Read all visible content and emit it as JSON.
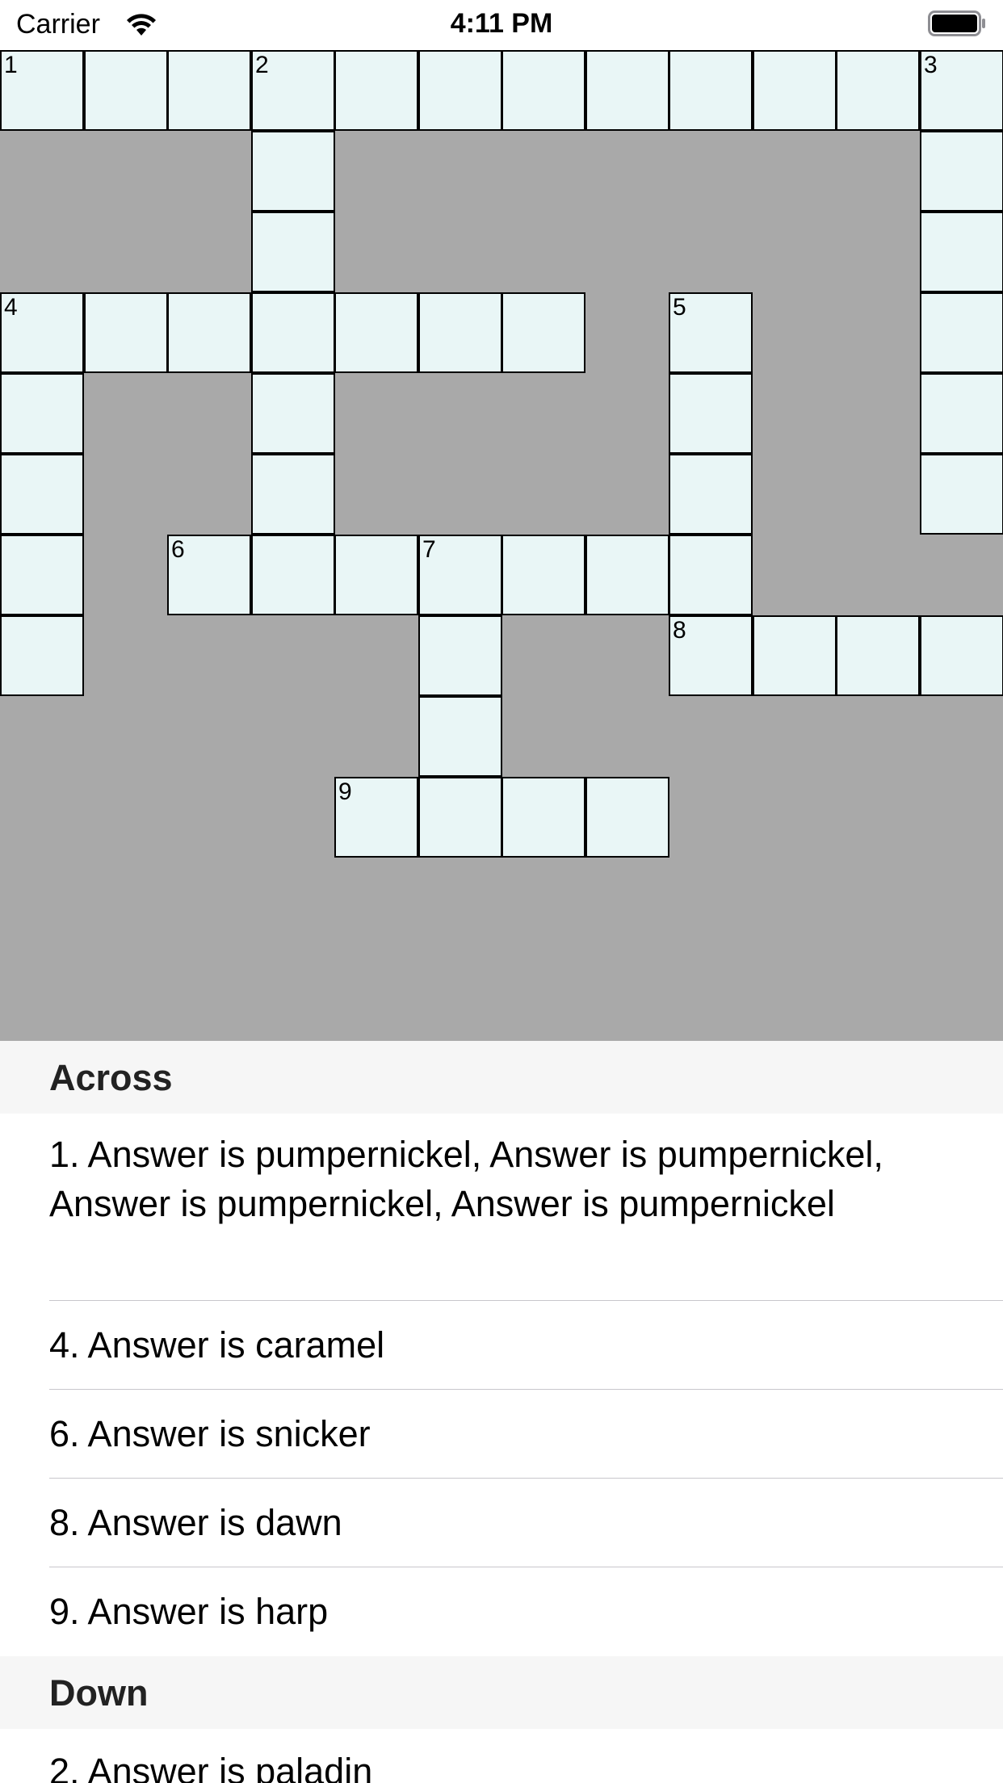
{
  "status_bar": {
    "carrier": "Carrier",
    "time": "4:11 PM",
    "wifi_icon": "wifi-icon",
    "battery_icon": "battery-icon"
  },
  "colors": {
    "board_background": "#a9a9a9",
    "cell_fill": "#e9f6f6",
    "cell_border": "#000000",
    "section_header_bg": "#f6f6f6",
    "separator": "#c8c7cc"
  },
  "crossword": {
    "rows": 12,
    "cols": 12,
    "cells": [
      [
        0,
        0,
        "1"
      ],
      [
        0,
        1,
        ""
      ],
      [
        0,
        2,
        ""
      ],
      [
        0,
        3,
        "2"
      ],
      [
        0,
        4,
        ""
      ],
      [
        0,
        5,
        ""
      ],
      [
        0,
        6,
        ""
      ],
      [
        0,
        7,
        ""
      ],
      [
        0,
        8,
        ""
      ],
      [
        0,
        9,
        ""
      ],
      [
        0,
        10,
        ""
      ],
      [
        0,
        11,
        "3"
      ],
      [
        1,
        3,
        ""
      ],
      [
        1,
        11,
        ""
      ],
      [
        2,
        3,
        ""
      ],
      [
        2,
        11,
        ""
      ],
      [
        3,
        0,
        "4"
      ],
      [
        3,
        1,
        ""
      ],
      [
        3,
        2,
        ""
      ],
      [
        3,
        3,
        ""
      ],
      [
        3,
        4,
        ""
      ],
      [
        3,
        5,
        ""
      ],
      [
        3,
        6,
        ""
      ],
      [
        3,
        8,
        "5"
      ],
      [
        3,
        11,
        ""
      ],
      [
        4,
        0,
        ""
      ],
      [
        4,
        3,
        ""
      ],
      [
        4,
        8,
        ""
      ],
      [
        4,
        11,
        ""
      ],
      [
        5,
        0,
        ""
      ],
      [
        5,
        3,
        ""
      ],
      [
        5,
        8,
        ""
      ],
      [
        5,
        11,
        ""
      ],
      [
        6,
        0,
        ""
      ],
      [
        6,
        2,
        "6"
      ],
      [
        6,
        3,
        ""
      ],
      [
        6,
        4,
        ""
      ],
      [
        6,
        5,
        "7"
      ],
      [
        6,
        6,
        ""
      ],
      [
        6,
        7,
        ""
      ],
      [
        6,
        8,
        ""
      ],
      [
        7,
        0,
        ""
      ],
      [
        7,
        5,
        ""
      ],
      [
        7,
        8,
        "8"
      ],
      [
        7,
        9,
        ""
      ],
      [
        7,
        10,
        ""
      ],
      [
        7,
        11,
        ""
      ],
      [
        8,
        5,
        ""
      ],
      [
        9,
        4,
        "9"
      ],
      [
        9,
        5,
        ""
      ],
      [
        9,
        6,
        ""
      ],
      [
        9,
        7,
        ""
      ]
    ]
  },
  "clues": {
    "across_title": "Across",
    "across": [
      "1. Answer is pumpernickel, Answer is pumpernickel, Answer is pumpernickel, Answer is pumpernickel",
      "4. Answer is caramel",
      "6. Answer is snicker",
      "8. Answer is dawn",
      "9. Answer is harp"
    ],
    "down_title": "Down",
    "down": [
      "2. Answer is paladin"
    ]
  }
}
